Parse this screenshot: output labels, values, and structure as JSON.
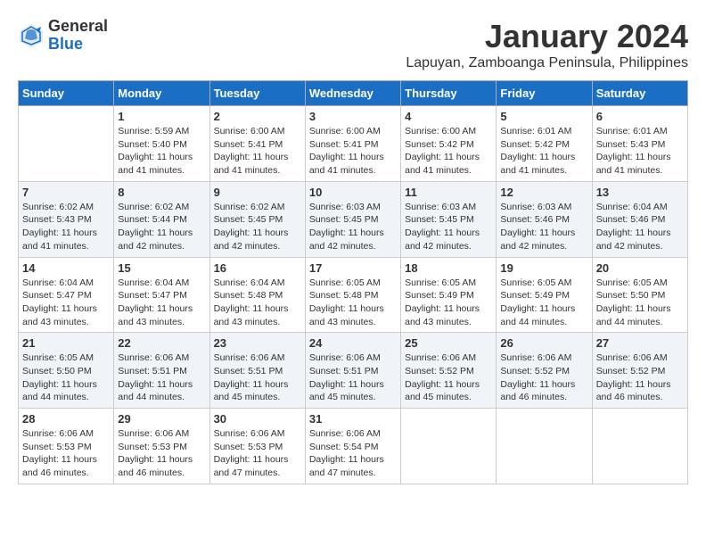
{
  "header": {
    "logo": {
      "general": "General",
      "blue": "Blue"
    },
    "title": "January 2024",
    "subtitle": "Lapuyan, Zamboanga Peninsula, Philippines"
  },
  "days_of_week": [
    "Sunday",
    "Monday",
    "Tuesday",
    "Wednesday",
    "Thursday",
    "Friday",
    "Saturday"
  ],
  "weeks": [
    [
      {
        "day": "",
        "info": ""
      },
      {
        "day": "1",
        "info": "Sunrise: 5:59 AM\nSunset: 5:40 PM\nDaylight: 11 hours\nand 41 minutes."
      },
      {
        "day": "2",
        "info": "Sunrise: 6:00 AM\nSunset: 5:41 PM\nDaylight: 11 hours\nand 41 minutes."
      },
      {
        "day": "3",
        "info": "Sunrise: 6:00 AM\nSunset: 5:41 PM\nDaylight: 11 hours\nand 41 minutes."
      },
      {
        "day": "4",
        "info": "Sunrise: 6:00 AM\nSunset: 5:42 PM\nDaylight: 11 hours\nand 41 minutes."
      },
      {
        "day": "5",
        "info": "Sunrise: 6:01 AM\nSunset: 5:42 PM\nDaylight: 11 hours\nand 41 minutes."
      },
      {
        "day": "6",
        "info": "Sunrise: 6:01 AM\nSunset: 5:43 PM\nDaylight: 11 hours\nand 41 minutes."
      }
    ],
    [
      {
        "day": "7",
        "info": "Sunrise: 6:02 AM\nSunset: 5:43 PM\nDaylight: 11 hours\nand 41 minutes."
      },
      {
        "day": "8",
        "info": "Sunrise: 6:02 AM\nSunset: 5:44 PM\nDaylight: 11 hours\nand 42 minutes."
      },
      {
        "day": "9",
        "info": "Sunrise: 6:02 AM\nSunset: 5:45 PM\nDaylight: 11 hours\nand 42 minutes."
      },
      {
        "day": "10",
        "info": "Sunrise: 6:03 AM\nSunset: 5:45 PM\nDaylight: 11 hours\nand 42 minutes."
      },
      {
        "day": "11",
        "info": "Sunrise: 6:03 AM\nSunset: 5:45 PM\nDaylight: 11 hours\nand 42 minutes."
      },
      {
        "day": "12",
        "info": "Sunrise: 6:03 AM\nSunset: 5:46 PM\nDaylight: 11 hours\nand 42 minutes."
      },
      {
        "day": "13",
        "info": "Sunrise: 6:04 AM\nSunset: 5:46 PM\nDaylight: 11 hours\nand 42 minutes."
      }
    ],
    [
      {
        "day": "14",
        "info": "Sunrise: 6:04 AM\nSunset: 5:47 PM\nDaylight: 11 hours\nand 43 minutes."
      },
      {
        "day": "15",
        "info": "Sunrise: 6:04 AM\nSunset: 5:47 PM\nDaylight: 11 hours\nand 43 minutes."
      },
      {
        "day": "16",
        "info": "Sunrise: 6:04 AM\nSunset: 5:48 PM\nDaylight: 11 hours\nand 43 minutes."
      },
      {
        "day": "17",
        "info": "Sunrise: 6:05 AM\nSunset: 5:48 PM\nDaylight: 11 hours\nand 43 minutes."
      },
      {
        "day": "18",
        "info": "Sunrise: 6:05 AM\nSunset: 5:49 PM\nDaylight: 11 hours\nand 43 minutes."
      },
      {
        "day": "19",
        "info": "Sunrise: 6:05 AM\nSunset: 5:49 PM\nDaylight: 11 hours\nand 44 minutes."
      },
      {
        "day": "20",
        "info": "Sunrise: 6:05 AM\nSunset: 5:50 PM\nDaylight: 11 hours\nand 44 minutes."
      }
    ],
    [
      {
        "day": "21",
        "info": "Sunrise: 6:05 AM\nSunset: 5:50 PM\nDaylight: 11 hours\nand 44 minutes."
      },
      {
        "day": "22",
        "info": "Sunrise: 6:06 AM\nSunset: 5:51 PM\nDaylight: 11 hours\nand 44 minutes."
      },
      {
        "day": "23",
        "info": "Sunrise: 6:06 AM\nSunset: 5:51 PM\nDaylight: 11 hours\nand 45 minutes."
      },
      {
        "day": "24",
        "info": "Sunrise: 6:06 AM\nSunset: 5:51 PM\nDaylight: 11 hours\nand 45 minutes."
      },
      {
        "day": "25",
        "info": "Sunrise: 6:06 AM\nSunset: 5:52 PM\nDaylight: 11 hours\nand 45 minutes."
      },
      {
        "day": "26",
        "info": "Sunrise: 6:06 AM\nSunset: 5:52 PM\nDaylight: 11 hours\nand 46 minutes."
      },
      {
        "day": "27",
        "info": "Sunrise: 6:06 AM\nSunset: 5:52 PM\nDaylight: 11 hours\nand 46 minutes."
      }
    ],
    [
      {
        "day": "28",
        "info": "Sunrise: 6:06 AM\nSunset: 5:53 PM\nDaylight: 11 hours\nand 46 minutes."
      },
      {
        "day": "29",
        "info": "Sunrise: 6:06 AM\nSunset: 5:53 PM\nDaylight: 11 hours\nand 46 minutes."
      },
      {
        "day": "30",
        "info": "Sunrise: 6:06 AM\nSunset: 5:53 PM\nDaylight: 11 hours\nand 47 minutes."
      },
      {
        "day": "31",
        "info": "Sunrise: 6:06 AM\nSunset: 5:54 PM\nDaylight: 11 hours\nand 47 minutes."
      },
      {
        "day": "",
        "info": ""
      },
      {
        "day": "",
        "info": ""
      },
      {
        "day": "",
        "info": ""
      }
    ]
  ]
}
